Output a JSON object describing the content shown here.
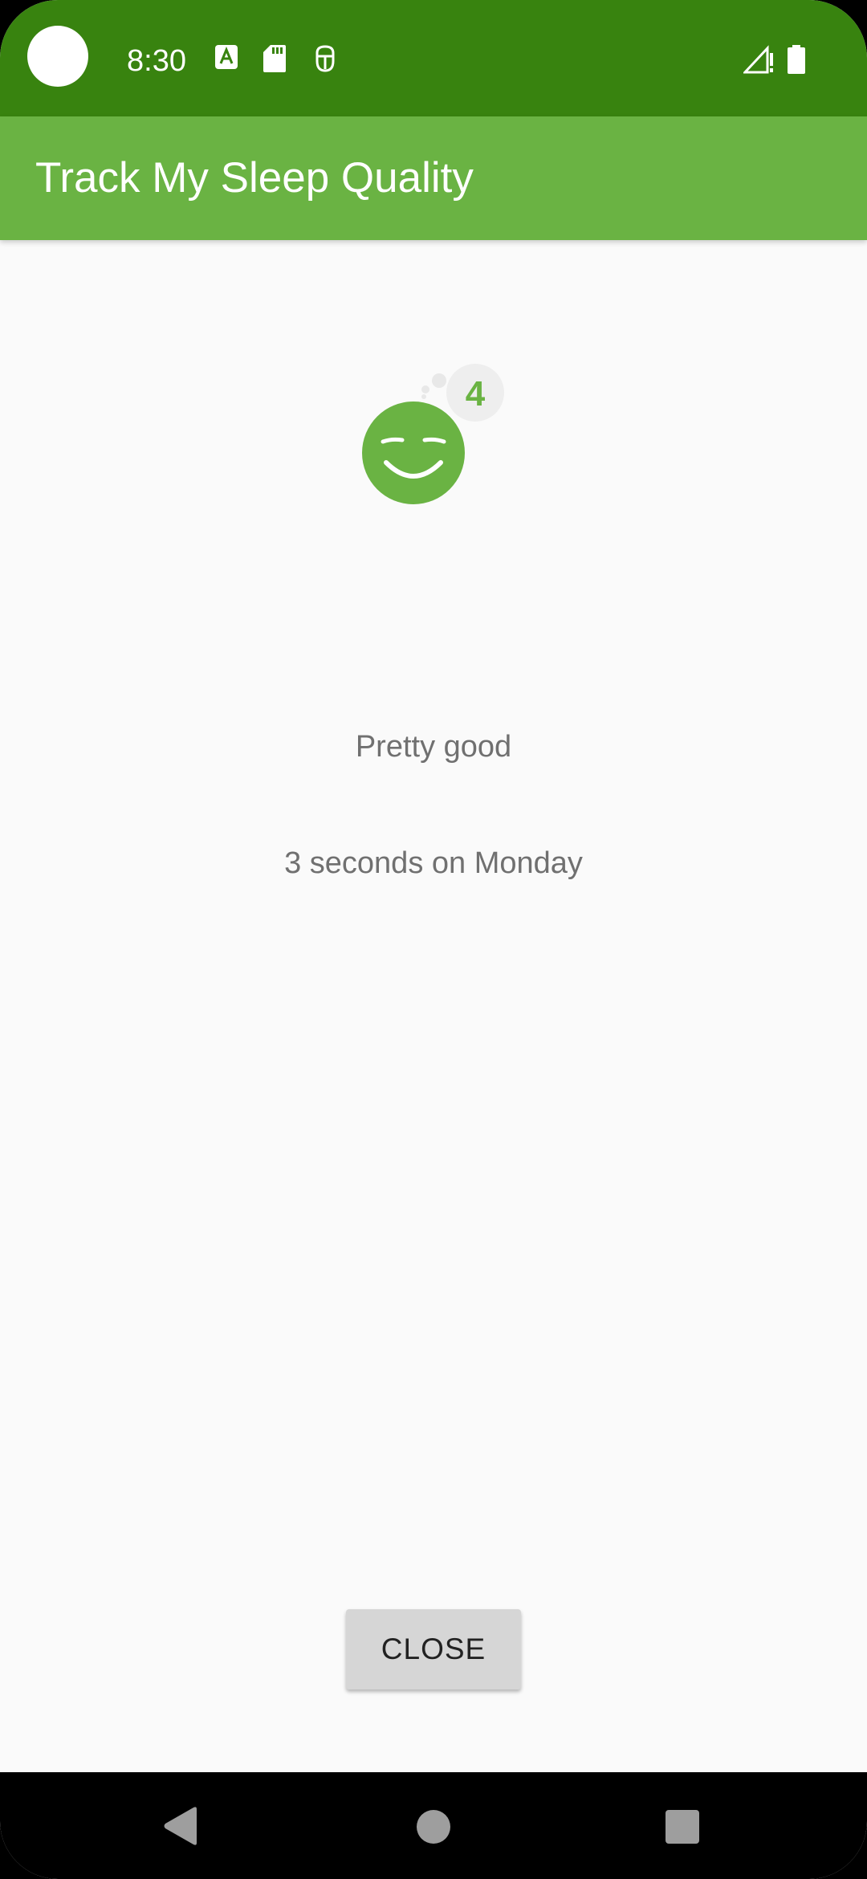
{
  "status_bar": {
    "time": "8:30",
    "color": "#38830f",
    "icons": [
      "camera-cutout",
      "font-a-icon",
      "sd-card-icon",
      "android-debug-icon",
      "signal-icon",
      "battery-icon"
    ]
  },
  "app_bar": {
    "title": "Track My Sleep Quality",
    "color": "#6ab343"
  },
  "sleep_detail": {
    "quality_image_icon": "sleep-quality-4-icon",
    "quality_badge": "4",
    "quality_text": "Pretty good",
    "duration_text": "3 seconds on Monday"
  },
  "actions": {
    "close_label": "CLOSE"
  },
  "nav_bar": {
    "icons": [
      "back-icon",
      "home-icon",
      "recents-icon"
    ]
  }
}
